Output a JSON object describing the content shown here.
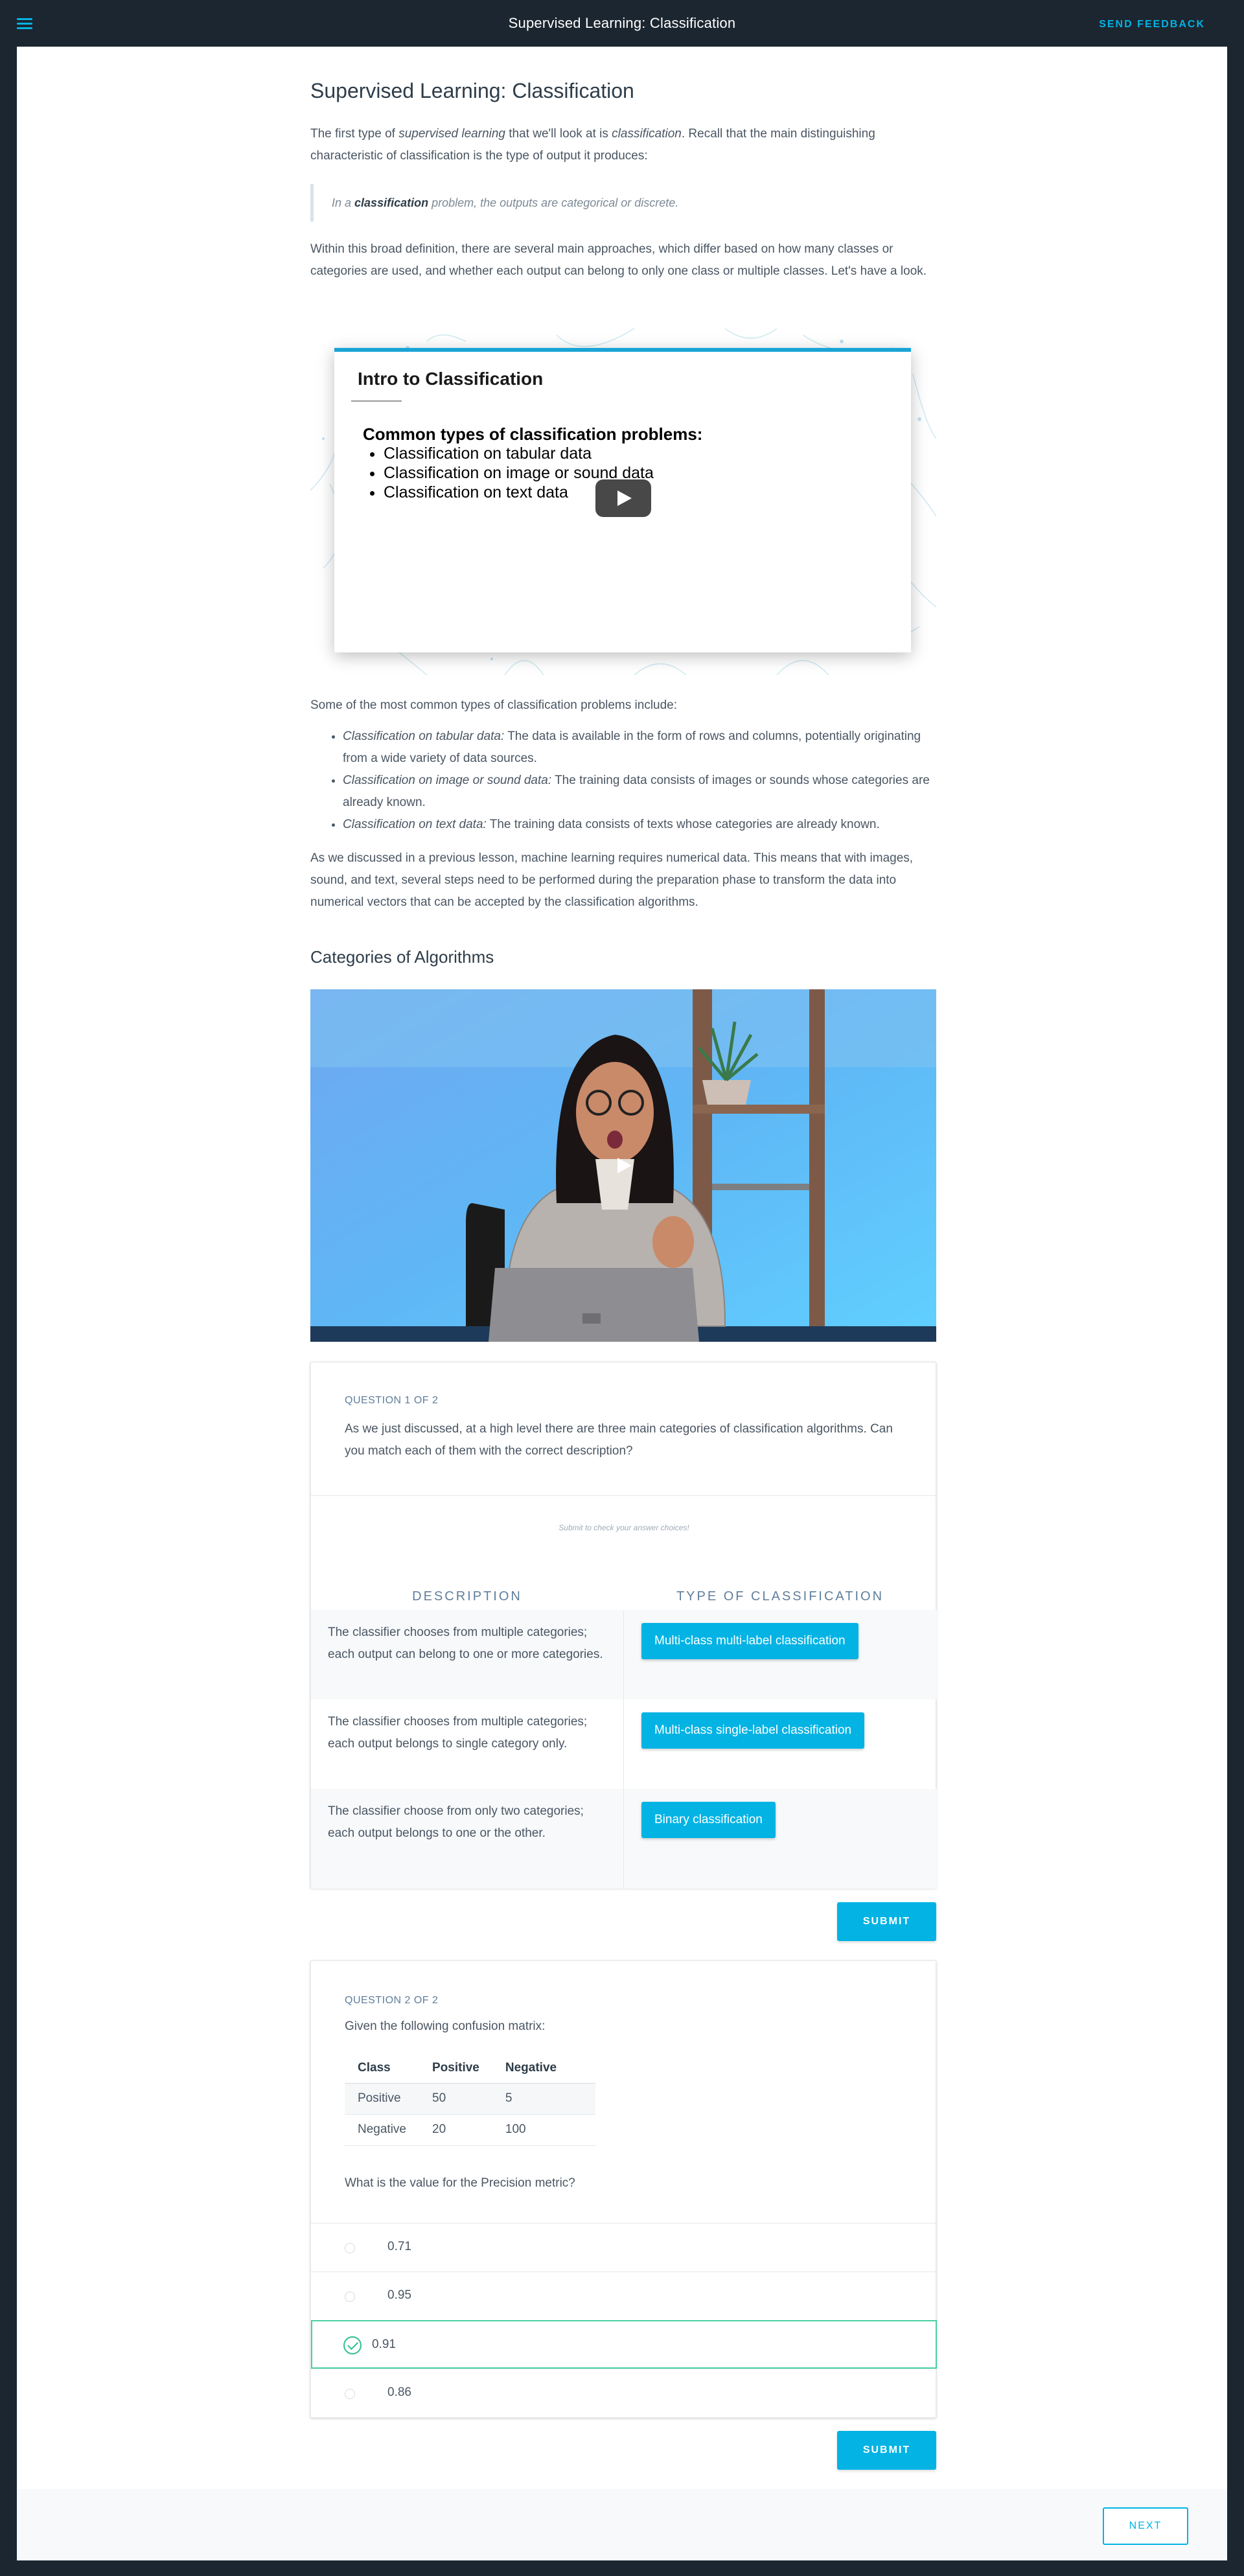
{
  "topbar": {
    "title": "Supervised Learning: Classification",
    "feedback": "SEND FEEDBACK"
  },
  "lesson": {
    "title": "Supervised Learning: Classification",
    "p1_a": "The first type of ",
    "p1_em1": "supervised learning",
    "p1_b": " that we'll look at is ",
    "p1_em2": "classification",
    "p1_c": ". Recall that the main distinguishing characteristic of classification is the type of output it produces:",
    "quote_a": "In a ",
    "quote_b": "classification",
    "quote_c": " problem, the outputs are categorical or discrete.",
    "p2": "Within this broad definition, there are several main approaches, which differ based on how many classes or categories are used, and whether each output can belong to only one class or multiple classes. Let's have a look.",
    "video1": {
      "title": "Intro to Classification",
      "subtitle": "Common types of classification problems:",
      "items": [
        "Classification on tabular data",
        "Classification on image or sound data",
        "Classification on text data"
      ]
    },
    "p3": "Some of the most common types of classification problems include:",
    "types": [
      {
        "em": "Classification on tabular data:",
        "text": " The data is available in the form of rows and columns, potentially originating from a wide variety of data sources."
      },
      {
        "em": "Classification on image or sound data:",
        "text": " The training data consists of images or sounds whose categories are already known."
      },
      {
        "em": "Classification on text data:",
        "text": " The training data consists of texts whose categories are already known."
      }
    ],
    "p4": "As we discussed in a previous lesson, machine learning requires numerical data. This means that with images, sound, and text, several steps need to be performed during the preparation phase to transform the data into numerical vectors that can be accepted by the classification algorithms.",
    "section2": "Categories of Algorithms"
  },
  "quiz1": {
    "label": "QUESTION 1 OF 2",
    "question": "As we just discussed, at a high level there are three main categories of classification algorithms. Can you match each of them with the correct description?",
    "hint": "Submit to check your answer choices!",
    "col_desc": "DESCRIPTION",
    "col_type": "TYPE OF CLASSIFICATION",
    "rows": [
      {
        "desc": "The classifier chooses from multiple categories; each output can belong to one or more categories.",
        "type": "Multi-class multi-label classification"
      },
      {
        "desc": "The classifier chooses from multiple categories; each output belongs to single category only.",
        "type": "Multi-class single-label classification"
      },
      {
        "desc": "The classifier choose from only two categories; each output belongs to one or the other.",
        "type": "Binary classification"
      }
    ],
    "submit": "SUBMIT"
  },
  "quiz2": {
    "label": "QUESTION 2 OF 2",
    "intro": "Given the following confusion matrix:",
    "matrix": {
      "headers": [
        "Class",
        "Positive",
        "Negative"
      ],
      "rows": [
        [
          "Positive",
          "50",
          "5"
        ],
        [
          "Negative",
          "20",
          "100"
        ]
      ]
    },
    "question": "What is the value for the Precision metric?",
    "options": [
      "0.71",
      "0.95",
      "0.91",
      "0.86"
    ],
    "selected": "0.91",
    "submit": "SUBMIT"
  },
  "footer": {
    "next": "NEXT"
  },
  "colors": {
    "accent": "#02b3e4",
    "success": "#2fbf8f",
    "dark": "#1c2630"
  }
}
